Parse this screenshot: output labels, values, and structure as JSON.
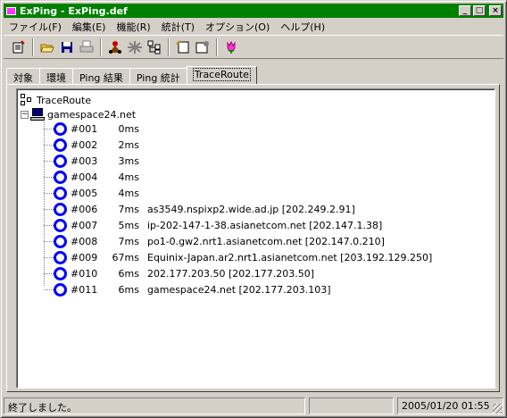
{
  "window": {
    "title": "ExPing - ExPing.def",
    "buttons": {
      "minimize": "_",
      "maximize": "□",
      "close": "×"
    }
  },
  "menu": [
    "ファイル(F)",
    "編集(E)",
    "機能(R)",
    "統計(T)",
    "オプション(O)",
    "ヘルプ(H)"
  ],
  "toolbar": {
    "icons": [
      "new-list-icon",
      "open-folder-icon",
      "save-icon",
      "print-icon",
      "ping-icon",
      "traceroute-icon",
      "network-tree-icon",
      "notes-icon",
      "properties-icon",
      "tulip-icon"
    ]
  },
  "tabs": [
    "対象",
    "環境",
    "Ping 結果",
    "Ping 統計",
    "TraceRoute"
  ],
  "active_tab": "TraceRoute",
  "tree": {
    "root_label": "TraceRoute",
    "host": "gamespace24.net",
    "hops": [
      {
        "num": "#001",
        "time": "0ms",
        "detail": ""
      },
      {
        "num": "#002",
        "time": "2ms",
        "detail": ""
      },
      {
        "num": "#003",
        "time": "3ms",
        "detail": ""
      },
      {
        "num": "#004",
        "time": "4ms",
        "detail": ""
      },
      {
        "num": "#005",
        "time": "4ms",
        "detail": ""
      },
      {
        "num": "#006",
        "time": "7ms",
        "detail": "as3549.nspixp2.wide.ad.jp [202.249.2.91]"
      },
      {
        "num": "#007",
        "time": "5ms",
        "detail": "ip-202-147-1-38.asianetcom.net [202.147.1.38]"
      },
      {
        "num": "#008",
        "time": "7ms",
        "detail": "po1-0.gw2.nrt1.asianetcom.net [202.147.0.210]"
      },
      {
        "num": "#009",
        "time": "67ms",
        "detail": "Equinix-Japan.ar2.nrt1.asianetcom.net [203.192.129.250]"
      },
      {
        "num": "#010",
        "time": "6ms",
        "detail": "202.177.203.50 [202.177.203.50]"
      },
      {
        "num": "#011",
        "time": "6ms",
        "detail": "gamespace24.net [202.177.203.103]"
      }
    ]
  },
  "status": {
    "message": "終了しました。",
    "datetime": "2005/01/20 01:55"
  }
}
